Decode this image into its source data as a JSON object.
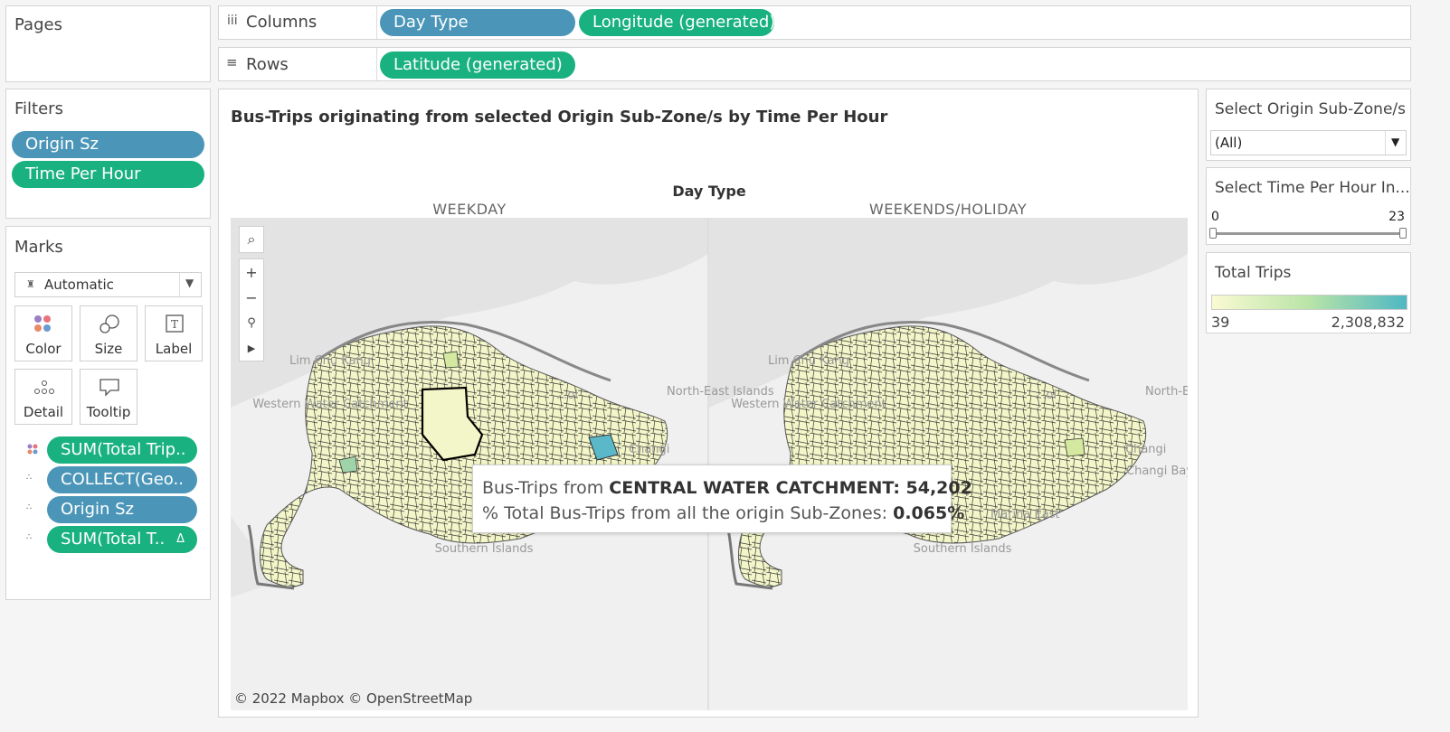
{
  "pages_panel": {
    "title": "Pages"
  },
  "columns_shelf": {
    "label": "Columns",
    "pills": [
      "Day Type",
      "Longitude (generated)"
    ]
  },
  "rows_shelf": {
    "label": "Rows",
    "pills": [
      "Latitude (generated)"
    ]
  },
  "filters_panel": {
    "title": "Filters",
    "pills": [
      "Origin Sz",
      "Time Per Hour"
    ]
  },
  "marks_panel": {
    "title": "Marks",
    "mark_type": "Automatic",
    "buttons": [
      "Color",
      "Size",
      "Label",
      "Detail",
      "Tooltip"
    ],
    "fields": [
      "SUM(Total Trip..",
      "COLLECT(Geo..",
      "Origin Sz",
      "SUM(Total T.."
    ],
    "delta_symbol": "Δ"
  },
  "viz": {
    "title": "Bus-Trips originating from selected Origin Sub-Zone/s by Time Per Hour",
    "header": "Day Type",
    "panes": [
      "WEEKDAY",
      "WEEKENDS/HOLIDAY"
    ],
    "attribution": "© 2022 Mapbox © OpenStreetMap",
    "map_labels": {
      "lim_chu_kang": "Lim Chu Kang",
      "western_water": "Western Water Catchment",
      "north_east_islands": "North-East Islands",
      "changi": "Changi",
      "changi_bay": "Changi Bay",
      "southern_islands": "Southern Islands",
      "marina_east": "Marina East",
      "seletar_fragment": "...ol"
    }
  },
  "tooltip": {
    "line1_prefix": "Bus-Trips from ",
    "line1_zone": "CENTRAL WATER CATCHMENT",
    "line1_value": ": 54,202",
    "line2_prefix": "% Total Bus-Trips from all the origin Sub-Zones: ",
    "line2_value": "0.065%"
  },
  "origin_filter": {
    "title": "Select Origin Sub-Zone/s",
    "value": "(All)"
  },
  "time_filter": {
    "title": "Select Time Per Hour In...",
    "min": "0",
    "max": "23"
  },
  "legend": {
    "title": "Total Trips",
    "min": "39",
    "max": "2,308,832",
    "color_low": "#fafad2",
    "color_high": "#4fb8c3"
  },
  "colors": {
    "pill_blue": "#4b96b8",
    "pill_green": "#19b17f"
  },
  "icons": [
    "columns-icon",
    "rows-icon",
    "search-icon",
    "zoom-in-icon",
    "zoom-out-icon",
    "pin-icon",
    "expand-arrow-icon",
    "color-icon",
    "size-icon",
    "label-icon",
    "detail-icon",
    "tooltip-icon",
    "dropdown-icon"
  ]
}
